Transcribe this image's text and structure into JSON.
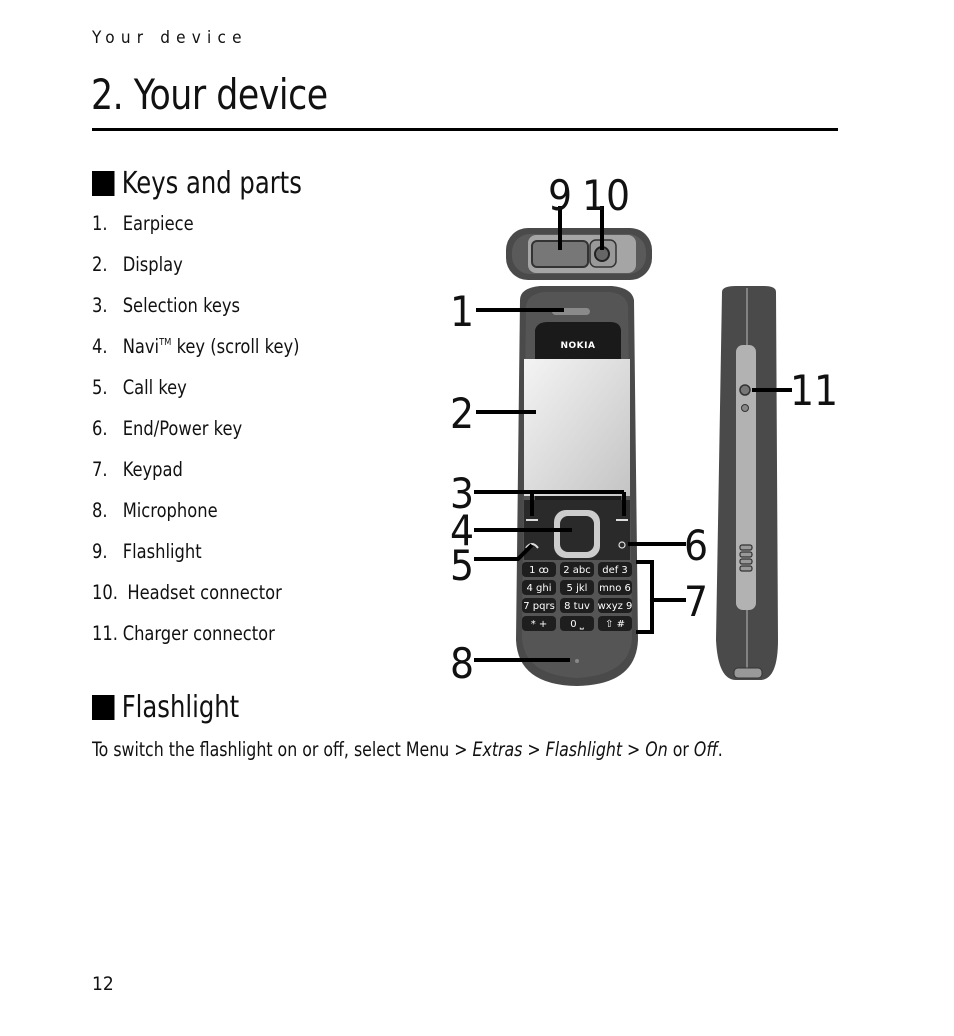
{
  "running_head": "Your device",
  "chapter_title": "2. Your device",
  "sections": {
    "keys_and_parts": {
      "heading": "Keys and parts",
      "items": [
        {
          "num": "1.",
          "label": "Earpiece"
        },
        {
          "num": "2.",
          "label": "Display"
        },
        {
          "num": "3.",
          "label": "Selection keys"
        },
        {
          "num": "4.",
          "label_pre": "Navi",
          "label_sup": "TM",
          "label_post": " key (scroll key)"
        },
        {
          "num": "5.",
          "label": "Call key"
        },
        {
          "num": "6.",
          "label": "End/Power key"
        },
        {
          "num": "7.",
          "label": "Keypad"
        },
        {
          "num": "8.",
          "label": "Microphone"
        },
        {
          "num": "9.",
          "label": "Flashlight"
        },
        {
          "num": "10.",
          "label": "Headset connector"
        },
        {
          "num": "11.",
          "label": "Charger connector"
        }
      ]
    },
    "flashlight": {
      "heading": "Flashlight",
      "text_pre": "To switch the flashlight on or off, select ",
      "menu": "Menu",
      "sep1": " > ",
      "extras": "Extras",
      "sep2": " > ",
      "flashlight": "Flashlight",
      "sep3": " > ",
      "on": "On",
      "or": " or ",
      "off": "Off",
      "end": "."
    }
  },
  "figure": {
    "brand": "NOKIA",
    "callouts": [
      "1",
      "2",
      "3",
      "4",
      "5",
      "6",
      "7",
      "8",
      "9",
      "10",
      "11"
    ],
    "keypad": [
      [
        "1 ꝏ",
        "2 abc",
        "def 3"
      ],
      [
        "4 ghi",
        "5 jkl",
        "mno 6"
      ],
      [
        "7 pqrs",
        "8 tuv",
        "wxyz 9"
      ],
      [
        "* +",
        "0 ⎵",
        "⇧ #"
      ]
    ]
  },
  "page_number": "12"
}
